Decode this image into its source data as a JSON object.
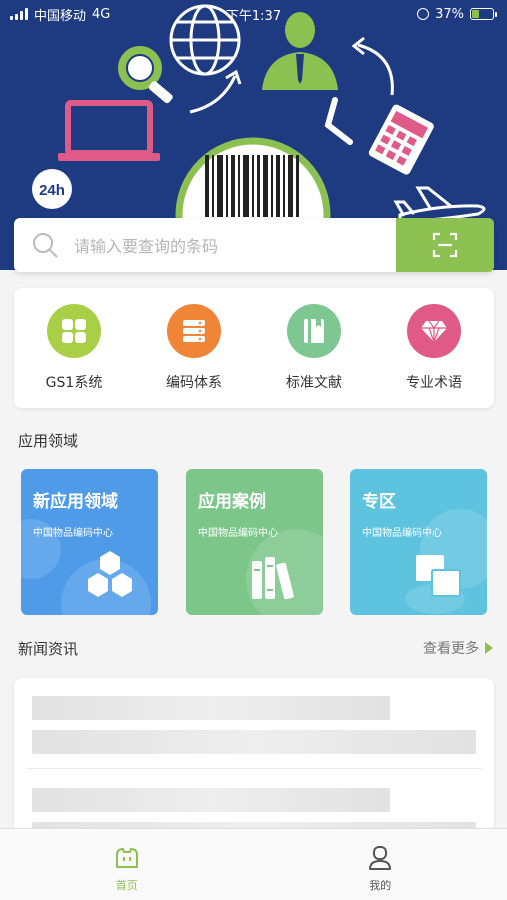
{
  "status_bar": {
    "carrier": "中国移动",
    "network": "4G",
    "time": "下午1:37",
    "battery": "37%",
    "battery_level": 0.37
  },
  "banner": {
    "badge_24h": "24h"
  },
  "search": {
    "placeholder": "请输入要查询的条码"
  },
  "categories": [
    {
      "label": "GS1系统",
      "color": "#a8cf45",
      "icon": "grid-icon"
    },
    {
      "label": "编码体系",
      "color": "#f08437",
      "icon": "stack-icon"
    },
    {
      "label": "标准文献",
      "color": "#7fc792",
      "icon": "book-icon"
    },
    {
      "label": "专业术语",
      "color": "#e05a88",
      "icon": "diamond-icon"
    }
  ],
  "app_section": {
    "title": "应用领域"
  },
  "app_tiles": [
    {
      "title": "新应用领域",
      "subtitle": "中国物品编码中心",
      "color": "#4f9be8",
      "icon": "hexagons-icon"
    },
    {
      "title": "应用案例",
      "subtitle": "中国物品编码中心",
      "color": "#7cc68a",
      "icon": "books-icon"
    },
    {
      "title": "专区",
      "subtitle": "中国物品编码中心",
      "color": "#5dc3df",
      "icon": "overlap-squares-icon"
    }
  ],
  "news_section": {
    "title": "新闻资讯",
    "more_label": "查看更多"
  },
  "tabs": [
    {
      "label": "首页",
      "icon": "home-icon",
      "active": true
    },
    {
      "label": "我的",
      "icon": "user-icon",
      "active": false
    }
  ],
  "colors": {
    "accent": "#8cc152",
    "banner_bg": "#1e3a80"
  }
}
